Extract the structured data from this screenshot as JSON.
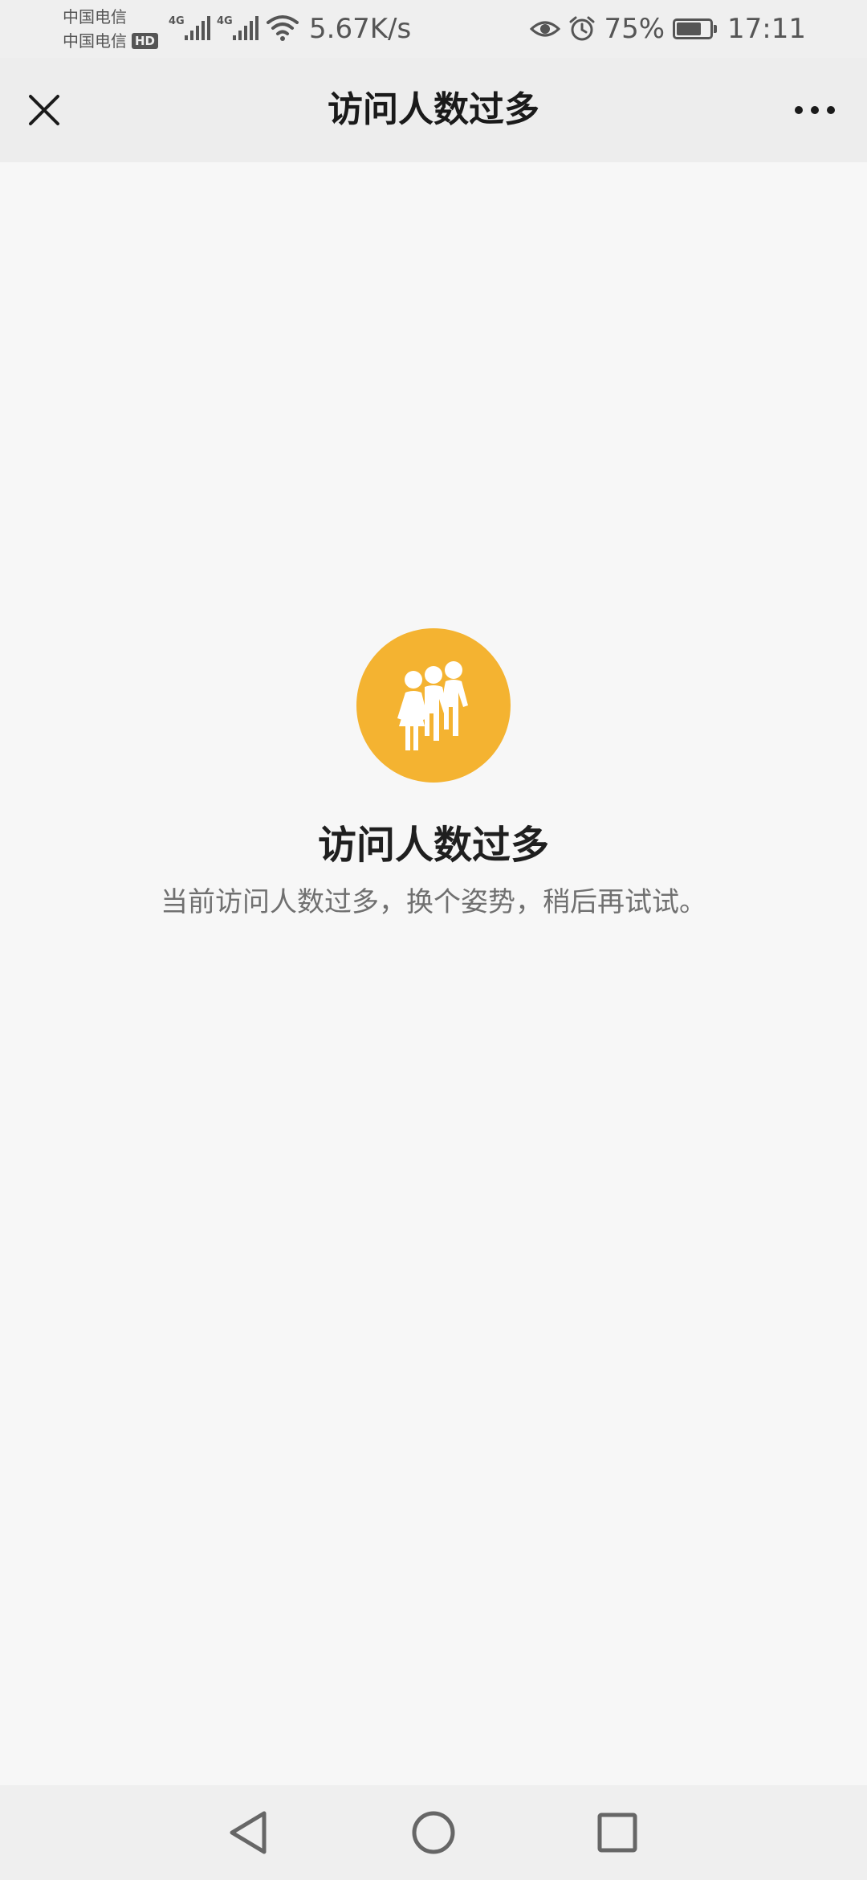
{
  "status_bar": {
    "carrier_1": "中国电信",
    "carrier_2": "中国电信",
    "hd_badge": "HD",
    "network_type_1": "4G",
    "network_type_2": "4G",
    "net_speed": "5.67K/s",
    "battery_percent": "75%",
    "battery_level": 0.75,
    "time": "17:11",
    "icons": [
      "eye-icon",
      "alarm-icon",
      "wifi-icon",
      "signal-icon",
      "battery-icon"
    ]
  },
  "nav_bar": {
    "title": "访问人数过多",
    "close_icon": "close-icon",
    "more_icon": "more-icon"
  },
  "message": {
    "icon": "crowd-icon",
    "icon_color": "#f4b331",
    "title": "访问人数过多",
    "description": "当前访问人数过多，换个姿势，稍后再试试。"
  },
  "system_nav": {
    "icons": [
      "back-icon",
      "home-icon",
      "recents-icon"
    ]
  }
}
